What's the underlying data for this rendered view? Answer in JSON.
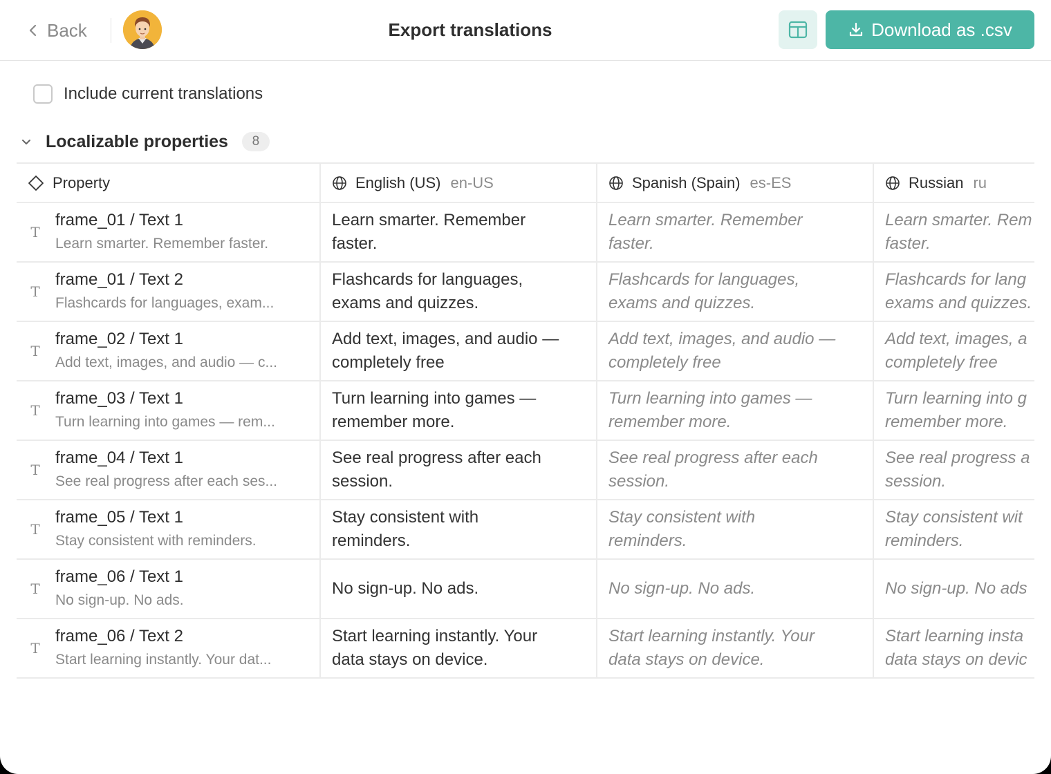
{
  "header": {
    "back_label": "Back",
    "title": "Export translations",
    "download_label": "Download as .csv"
  },
  "options": {
    "include_label": "Include current translations",
    "include_checked": false
  },
  "section": {
    "title": "Localizable properties",
    "count": "8"
  },
  "columns": [
    {
      "name": "Property",
      "code": ""
    },
    {
      "name": "English (US)",
      "code": "en-US"
    },
    {
      "name": "Spanish (Spain)",
      "code": "es-ES"
    },
    {
      "name": "Russian",
      "code": "ru"
    }
  ],
  "rows": [
    {
      "name": "frame_01 / Text 1",
      "sub": "Learn smarter. Remember faster.",
      "en": [
        "Learn smarter. Remember",
        "faster."
      ],
      "es": [
        "Learn smarter. Remember",
        "faster."
      ],
      "ru": [
        "Learn smarter. Rem",
        "faster."
      ]
    },
    {
      "name": "frame_01 / Text 2",
      "sub": "Flashcards for languages, exam...",
      "en": [
        "Flashcards for languages,",
        "exams and quizzes."
      ],
      "es": [
        "Flashcards for languages,",
        "exams and quizzes."
      ],
      "ru": [
        "Flashcards for lang",
        "exams and quizzes."
      ]
    },
    {
      "name": "frame_02 / Text 1",
      "sub": "Add text, images, and audio — c...",
      "en": [
        "Add text, images, and audio —",
        "completely free"
      ],
      "es": [
        "Add text, images, and audio —",
        "completely free"
      ],
      "ru": [
        "Add text, images, a",
        "completely free"
      ]
    },
    {
      "name": "frame_03 / Text 1",
      "sub": "Turn learning into games — rem...",
      "en": [
        "Turn learning into games —",
        "remember more."
      ],
      "es": [
        "Turn learning into games —",
        "remember more."
      ],
      "ru": [
        "Turn learning into g",
        "remember more."
      ]
    },
    {
      "name": "frame_04 / Text 1",
      "sub": "See real progress after each ses...",
      "en": [
        "See real progress after each",
        "session."
      ],
      "es": [
        "See real progress after each",
        "session."
      ],
      "ru": [
        "See real progress a",
        "session."
      ]
    },
    {
      "name": "frame_05 / Text 1",
      "sub": "Stay consistent with reminders.",
      "en": [
        "Stay consistent with",
        "reminders."
      ],
      "es": [
        "Stay consistent with",
        "reminders."
      ],
      "ru": [
        "Stay consistent wit",
        "reminders."
      ]
    },
    {
      "name": "frame_06 / Text 1",
      "sub": "No sign-up. No ads.",
      "en": [
        "No sign-up. No ads."
      ],
      "es": [
        "No sign-up. No ads."
      ],
      "ru": [
        "No sign-up. No ads"
      ]
    },
    {
      "name": "frame_06 / Text 2",
      "sub": "Start learning instantly. Your dat...",
      "en": [
        "Start learning instantly. Your",
        "data stays on device."
      ],
      "es": [
        "Start learning instantly. Your",
        "data stays on device."
      ],
      "ru": [
        "Start learning insta",
        "data stays on devic"
      ]
    }
  ],
  "colors": {
    "accent": "#4db6a6",
    "accent_light": "#e3f3f0"
  },
  "icons": {
    "back": "chevron-left-icon",
    "layout": "panel-layout-icon",
    "download": "download-icon",
    "section_toggle": "chevron-down-icon",
    "property_header": "diamond-icon",
    "language_header": "globe-icon",
    "row_type": "text-type-icon"
  }
}
